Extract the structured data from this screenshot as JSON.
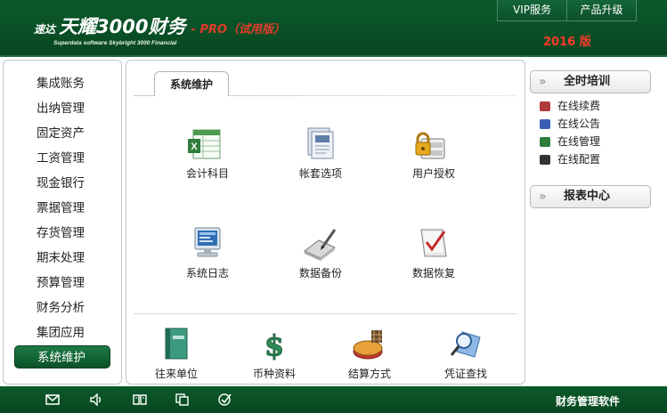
{
  "header": {
    "logo_prefix": "速达",
    "logo_main": "天耀3000财务",
    "logo_edition": "- PRO（试用版）",
    "logo_sub": "Superdata software Skybright 3000 Financial",
    "year": "2016 版",
    "nav": [
      "VIP服务",
      "产品升级"
    ]
  },
  "sidebar": {
    "items": [
      {
        "label": "集成账务"
      },
      {
        "label": "出纳管理"
      },
      {
        "label": "固定资产"
      },
      {
        "label": "工资管理"
      },
      {
        "label": "现金银行"
      },
      {
        "label": "票据管理"
      },
      {
        "label": "存货管理"
      },
      {
        "label": "期末处理"
      },
      {
        "label": "预算管理"
      },
      {
        "label": "财务分析"
      },
      {
        "label": "集团应用"
      },
      {
        "label": "系统维护"
      }
    ],
    "active": "系统维护"
  },
  "main": {
    "tab": "系统维护",
    "tiles": [
      {
        "label": "会计科目",
        "icon": "spreadsheet-icon"
      },
      {
        "label": "帐套选项",
        "icon": "folder-documents-icon"
      },
      {
        "label": "用户授权",
        "icon": "lock-user-icon"
      },
      {
        "label": "系统日志",
        "icon": "computer-monitor-icon"
      },
      {
        "label": "数据备份",
        "icon": "backup-edit-icon"
      },
      {
        "label": "数据恢复",
        "icon": "restore-check-icon"
      }
    ],
    "bottom_tiles": [
      {
        "label": "往来单位",
        "icon": "green-book-icon"
      },
      {
        "label": "币种资料",
        "icon": "currency-dollar-icon"
      },
      {
        "label": "结算方式",
        "icon": "settlement-coins-icon"
      },
      {
        "label": "凭证查找",
        "icon": "search-magnifier-icon"
      }
    ]
  },
  "right": {
    "training_title": "全时培训",
    "links": [
      {
        "label": "在线续费",
        "color": "#b23a3a"
      },
      {
        "label": "在线公告",
        "color": "#3a5fb2"
      },
      {
        "label": "在线管理",
        "color": "#2f7d3d"
      },
      {
        "label": "在线配置",
        "color": "#333333"
      }
    ],
    "report_title": "报表中心"
  },
  "footer": {
    "label": "财务管理软件",
    "icons": [
      "mail-icon",
      "speaker-icon",
      "book-icon",
      "copy-icon",
      "check-circle-icon"
    ]
  },
  "colors": {
    "brand_green": "#0b5a2b",
    "accent_red": "#ff3a2a"
  }
}
